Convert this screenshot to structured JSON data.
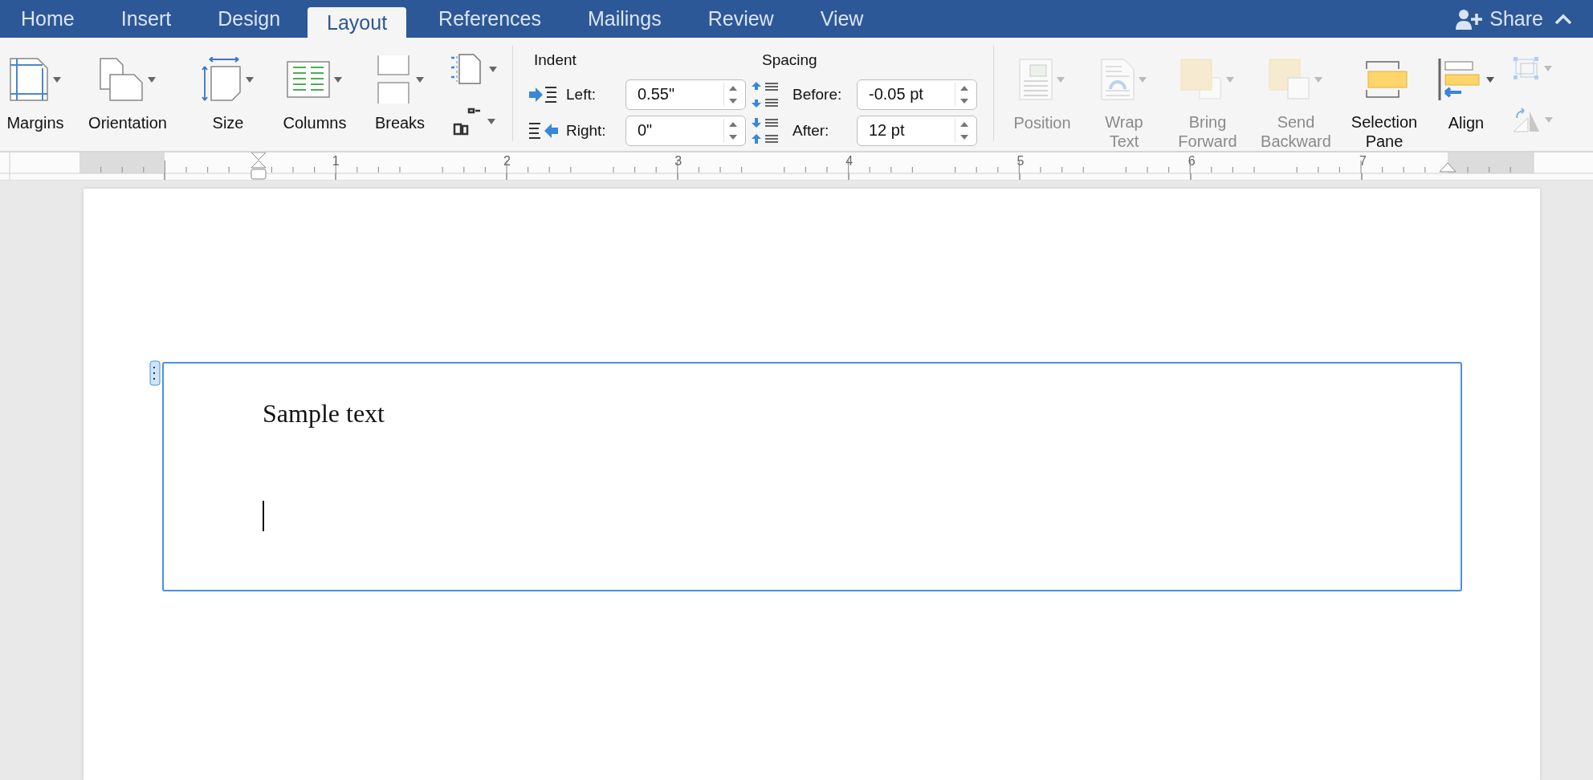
{
  "tabs": [
    {
      "label": "Home",
      "selected": false
    },
    {
      "label": "Insert",
      "selected": false
    },
    {
      "label": "Design",
      "selected": false
    },
    {
      "label": "Layout",
      "selected": true
    },
    {
      "label": "References",
      "selected": false
    },
    {
      "label": "Mailings",
      "selected": false
    },
    {
      "label": "Review",
      "selected": false
    },
    {
      "label": "View",
      "selected": false
    }
  ],
  "share": {
    "label": "Share"
  },
  "page_setup": [
    {
      "kind": "margins",
      "label": "Margins"
    },
    {
      "kind": "orientation",
      "label": "Orientation"
    },
    {
      "kind": "size",
      "label": "Size"
    },
    {
      "kind": "columns",
      "label": "Columns"
    },
    {
      "kind": "breaks",
      "label": "Breaks"
    }
  ],
  "paragraph": {
    "indent_title": "Indent",
    "spacing_title": "Spacing",
    "rows": [
      {
        "indent_label": "Left:",
        "indent_value": "0.55\"",
        "spacing_label": "Before:",
        "spacing_value": "-0.05 pt"
      },
      {
        "indent_label": "Right:",
        "indent_value": "0\"",
        "spacing_label": "After:",
        "spacing_value": "12 pt"
      }
    ]
  },
  "arrange": [
    {
      "kind": "position",
      "lines": [
        "Position"
      ],
      "disabled": true
    },
    {
      "kind": "wrap",
      "lines": [
        "Wrap",
        "Text"
      ],
      "disabled": true
    },
    {
      "kind": "forward",
      "lines": [
        "Bring",
        "Forward"
      ],
      "disabled": true
    },
    {
      "kind": "backward",
      "lines": [
        "Send",
        "Backward"
      ],
      "disabled": true
    },
    {
      "kind": "selection",
      "lines": [
        "Selection",
        "Pane"
      ],
      "disabled": false
    },
    {
      "kind": "align",
      "lines": [
        "Align"
      ],
      "disabled": false
    }
  ],
  "ruler": {
    "numbers": [
      "1",
      "2",
      "3",
      "4",
      "5",
      "6",
      "7"
    ]
  },
  "document": {
    "text_box": {
      "text": "Sample text"
    }
  }
}
